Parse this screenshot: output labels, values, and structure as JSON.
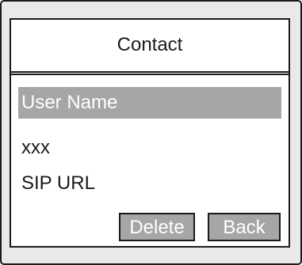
{
  "screen": {
    "title": "Contact"
  },
  "contact": {
    "fields": [
      {
        "label": "User Name",
        "selected": true
      },
      {
        "value": "xxx"
      },
      {
        "label": "SIP URL"
      }
    ]
  },
  "softkeys": {
    "delete_label": "Delete",
    "back_label": "Back"
  },
  "colors": {
    "frame": "#e9e9e9",
    "screen_bg": "#ffffff",
    "highlight": "#a6a6a6",
    "highlight_text": "#ffffff",
    "border": "#1a1a1a"
  }
}
